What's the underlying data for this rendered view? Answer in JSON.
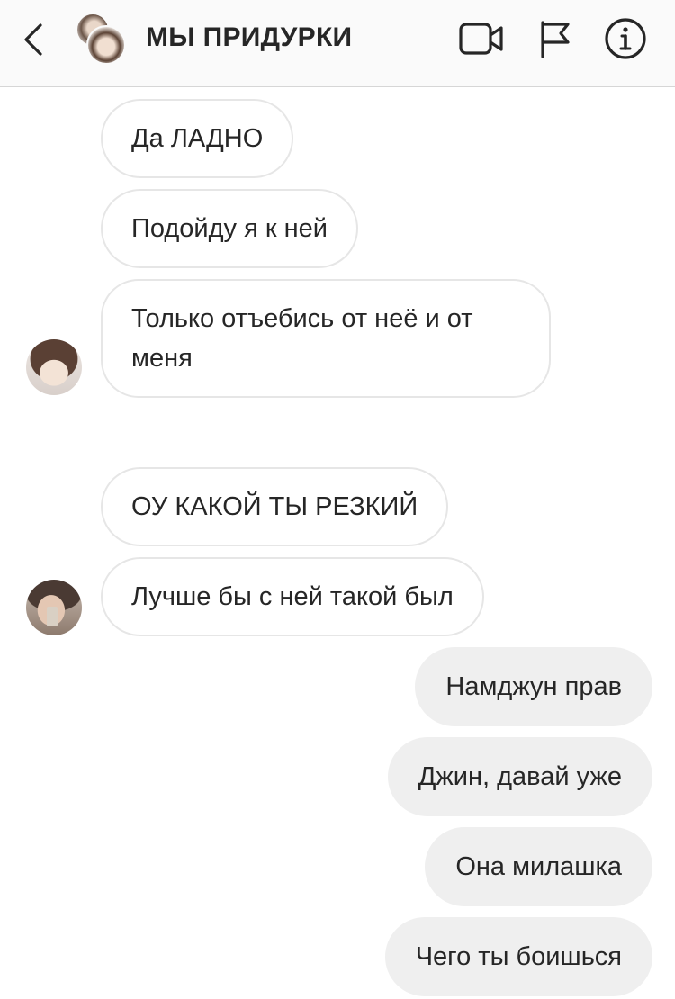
{
  "header": {
    "title": "МЫ ПРИДУРКИ",
    "icons": {
      "back": "chevron-left-icon",
      "video": "video-camera-icon",
      "flag": "flag-icon",
      "info": "info-icon"
    }
  },
  "messages": [
    {
      "side": "incoming",
      "text": "Да ЛАДНО"
    },
    {
      "side": "incoming",
      "text": "Подойду я к ней"
    },
    {
      "side": "incoming",
      "text": "Только отъебись от неё и от меня"
    },
    {
      "side": "incoming",
      "text": "ОУ КАКОЙ ТЫ РЕЗКИЙ"
    },
    {
      "side": "incoming",
      "text": "Лучше бы с ней такой был"
    },
    {
      "side": "outgoing",
      "text": "Намджун прав"
    },
    {
      "side": "outgoing",
      "text": "Джин, давай уже"
    },
    {
      "side": "outgoing",
      "text": "Она милашка"
    },
    {
      "side": "outgoing",
      "text": "Чего ты боишься"
    }
  ],
  "colors": {
    "incoming_bubble": "#ffffff",
    "incoming_border": "#e6e6e6",
    "outgoing_bubble": "#efefef",
    "text": "#262626",
    "header_bg": "#fafafa"
  }
}
